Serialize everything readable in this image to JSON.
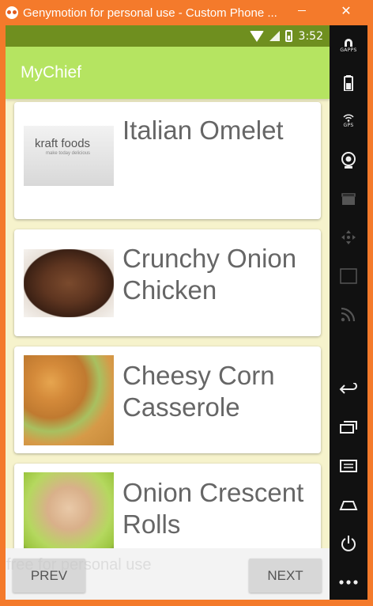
{
  "window": {
    "title": "Genymotion for personal use - Custom Phone ...",
    "minimize_label": "—",
    "close_label": "✕"
  },
  "statusbar": {
    "time": "3:52"
  },
  "appbar": {
    "title": "MyChief"
  },
  "recipes": [
    {
      "title": "Italian Omelet",
      "image": "kraft-foods-logo",
      "image_text": "kraft foods",
      "image_subtext": "make today delicious"
    },
    {
      "title": "Crunchy Onion Chicken",
      "image": "onion-chicken-photo"
    },
    {
      "title": "Cheesy Corn Casserole",
      "image": "corn-casserole-photo"
    },
    {
      "title": "Onion Crescent Rolls",
      "image": "crescent-rolls-photo"
    }
  ],
  "navigation": {
    "prev_label": "PREV",
    "next_label": "NEXT"
  },
  "watermark": "free for personal use",
  "side_toolbar": {
    "gps_label": "GPS",
    "gapps_label": "GAPPS",
    "id_label": "ID"
  },
  "colors": {
    "window_frame": "#f47a2b",
    "statusbar": "#6f8f1f",
    "appbar": "#b5e461",
    "list_background": "#f6f3cc"
  }
}
